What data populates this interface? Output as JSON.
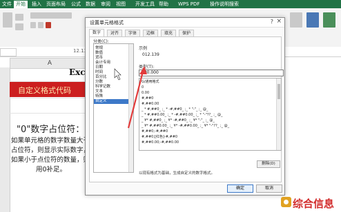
{
  "ribbon": {
    "tabs": [
      "文件",
      "开始",
      "插入",
      "页面布局",
      "公式",
      "数据",
      "审阅",
      "视图",
      "开发工具",
      "帮助",
      "WPS PDF",
      "操作说明搜索"
    ]
  },
  "formula_bar": {
    "value": "12.13"
  },
  "sheet": {
    "column_a": "A",
    "title_partial": "Exc",
    "red_band_text": "自定义格式代码",
    "zero_placeholder_text": "\"0\"数字占位符：",
    "lines": [
      "如果单元格的数字数量大于",
      "占位符，则显示实际数字，",
      "如果小于点位符的数量，则",
      "用0补足。"
    ]
  },
  "dialog": {
    "title": "设置单元格格式",
    "help": "?",
    "close": "×",
    "tabs": [
      "数字",
      "对齐",
      "字体",
      "边框",
      "填充",
      "保护"
    ],
    "active_tab": "数字",
    "category_label": "分类(C):",
    "categories": [
      "常规",
      "数值",
      "货币",
      "会计专用",
      "日期",
      "时间",
      "百分比",
      "分数",
      "科学记数",
      "文本",
      "特殊",
      "自定义"
    ],
    "selected_category": "自定义",
    "sample_label": "示例",
    "sample_value": "012.139",
    "type_label": "类型(T):",
    "type_value": "000.000",
    "format_list": [
      "G/通用格式",
      "0",
      "0.00",
      "#,##0",
      "#,##0.00",
      "_ * #,##0_ ;_ * -#,##0_ ;_ * \"-\"_ ;_ @_",
      "_ * #,##0.00_ ;_ * -#,##0.00_ ;_ * \"-\"??_ ;_ @_",
      "_ ¥* #,##0_ ;_ ¥* -#,##0_ ;_ ¥* \"-\"_ ;_ @_",
      "_ ¥* #,##0.00_ ;_ ¥* -#,##0.00_ ;_ ¥* \"-\"??_ ;_ @_",
      "#,##0;-#,##0",
      "#,##0;[红色]-#,##0",
      "#,##0.00;-#,##0.00"
    ],
    "delete_button": "删除(D)",
    "hint": "以现有格式为基础，生成自定义的数字格式。",
    "ok_button": "确定",
    "cancel_button": "取消"
  },
  "watermark": {
    "text": "综合信息"
  },
  "colors": {
    "ribbon": "#217346",
    "red_band": "#cc1f1f",
    "selection": "#3d79c8",
    "arrow": "#e23b3b"
  }
}
